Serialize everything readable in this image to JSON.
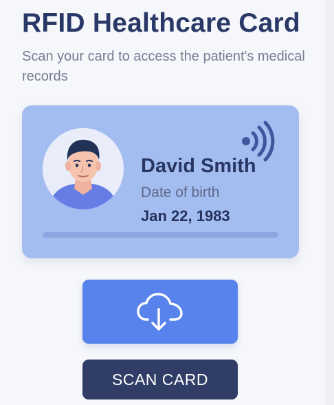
{
  "header": {
    "title": "RFID Healthcare Card",
    "subtitle": "Scan your card to access the patient's medical records"
  },
  "card": {
    "name": "David Smith",
    "dob_label": "Date of birth",
    "dob_value": "Jan 22, 1983",
    "avatar_icon": "patient-avatar",
    "rfid_icon": "rfid-signal-icon",
    "background_color": "#a3bdf1"
  },
  "actions": {
    "upload_icon": "cloud-download-icon",
    "scan_label": "SCAN CARD"
  },
  "colors": {
    "title": "#293866",
    "subtitle": "#737c91",
    "primary_button": "#5882ec",
    "secondary_button": "#2f3d67",
    "accent": "#3f569d"
  }
}
